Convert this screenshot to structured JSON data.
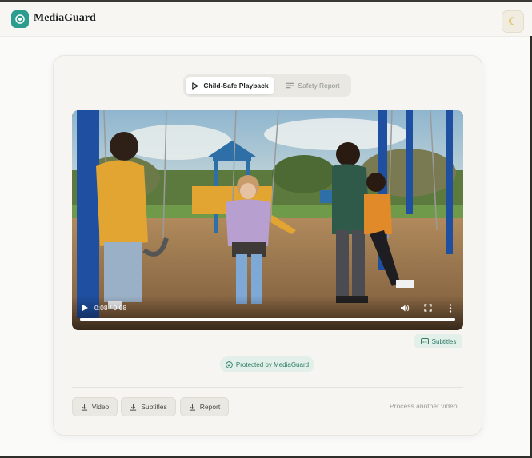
{
  "app": {
    "name": "MediaGuard",
    "theme_icon": "moon-icon",
    "brand_color": "#2a9d8f"
  },
  "tabs": [
    {
      "label": "Child-Safe Playback",
      "icon": "play-icon",
      "active": true
    },
    {
      "label": "Safety Report",
      "icon": "list-icon",
      "active": false
    }
  ],
  "video": {
    "time": "0:08 / 0:08",
    "progress_fraction": 1.0,
    "controls": [
      "play-icon",
      "volume-icon",
      "fullscreen-icon",
      "more-vert-icon"
    ]
  },
  "subtitles_button": {
    "label": "Subtitles",
    "icon": "subtitles-icon"
  },
  "protected_badge": {
    "label": "Protected by MediaGuard",
    "icon": "check-circle-icon"
  },
  "downloads": [
    {
      "label": "Video",
      "icon": "download-icon"
    },
    {
      "label": "Subtitles",
      "icon": "download-icon"
    },
    {
      "label": "Report",
      "icon": "download-icon"
    }
  ],
  "process_another": "Process another video",
  "colors": {
    "accent_soft": "#e3efe9",
    "accent_text": "#2d7b66"
  }
}
